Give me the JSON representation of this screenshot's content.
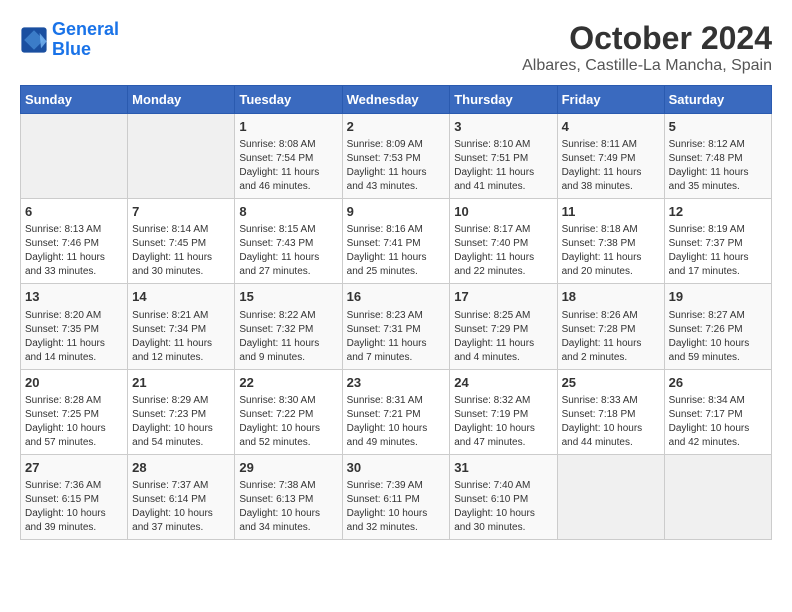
{
  "header": {
    "logo_line1": "General",
    "logo_line2": "Blue",
    "month": "October 2024",
    "location": "Albares, Castille-La Mancha, Spain"
  },
  "days_of_week": [
    "Sunday",
    "Monday",
    "Tuesday",
    "Wednesday",
    "Thursday",
    "Friday",
    "Saturday"
  ],
  "weeks": [
    [
      {
        "day": "",
        "info": ""
      },
      {
        "day": "",
        "info": ""
      },
      {
        "day": "1",
        "info": "Sunrise: 8:08 AM\nSunset: 7:54 PM\nDaylight: 11 hours and 46 minutes."
      },
      {
        "day": "2",
        "info": "Sunrise: 8:09 AM\nSunset: 7:53 PM\nDaylight: 11 hours and 43 minutes."
      },
      {
        "day": "3",
        "info": "Sunrise: 8:10 AM\nSunset: 7:51 PM\nDaylight: 11 hours and 41 minutes."
      },
      {
        "day": "4",
        "info": "Sunrise: 8:11 AM\nSunset: 7:49 PM\nDaylight: 11 hours and 38 minutes."
      },
      {
        "day": "5",
        "info": "Sunrise: 8:12 AM\nSunset: 7:48 PM\nDaylight: 11 hours and 35 minutes."
      }
    ],
    [
      {
        "day": "6",
        "info": "Sunrise: 8:13 AM\nSunset: 7:46 PM\nDaylight: 11 hours and 33 minutes."
      },
      {
        "day": "7",
        "info": "Sunrise: 8:14 AM\nSunset: 7:45 PM\nDaylight: 11 hours and 30 minutes."
      },
      {
        "day": "8",
        "info": "Sunrise: 8:15 AM\nSunset: 7:43 PM\nDaylight: 11 hours and 27 minutes."
      },
      {
        "day": "9",
        "info": "Sunrise: 8:16 AM\nSunset: 7:41 PM\nDaylight: 11 hours and 25 minutes."
      },
      {
        "day": "10",
        "info": "Sunrise: 8:17 AM\nSunset: 7:40 PM\nDaylight: 11 hours and 22 minutes."
      },
      {
        "day": "11",
        "info": "Sunrise: 8:18 AM\nSunset: 7:38 PM\nDaylight: 11 hours and 20 minutes."
      },
      {
        "day": "12",
        "info": "Sunrise: 8:19 AM\nSunset: 7:37 PM\nDaylight: 11 hours and 17 minutes."
      }
    ],
    [
      {
        "day": "13",
        "info": "Sunrise: 8:20 AM\nSunset: 7:35 PM\nDaylight: 11 hours and 14 minutes."
      },
      {
        "day": "14",
        "info": "Sunrise: 8:21 AM\nSunset: 7:34 PM\nDaylight: 11 hours and 12 minutes."
      },
      {
        "day": "15",
        "info": "Sunrise: 8:22 AM\nSunset: 7:32 PM\nDaylight: 11 hours and 9 minutes."
      },
      {
        "day": "16",
        "info": "Sunrise: 8:23 AM\nSunset: 7:31 PM\nDaylight: 11 hours and 7 minutes."
      },
      {
        "day": "17",
        "info": "Sunrise: 8:25 AM\nSunset: 7:29 PM\nDaylight: 11 hours and 4 minutes."
      },
      {
        "day": "18",
        "info": "Sunrise: 8:26 AM\nSunset: 7:28 PM\nDaylight: 11 hours and 2 minutes."
      },
      {
        "day": "19",
        "info": "Sunrise: 8:27 AM\nSunset: 7:26 PM\nDaylight: 10 hours and 59 minutes."
      }
    ],
    [
      {
        "day": "20",
        "info": "Sunrise: 8:28 AM\nSunset: 7:25 PM\nDaylight: 10 hours and 57 minutes."
      },
      {
        "day": "21",
        "info": "Sunrise: 8:29 AM\nSunset: 7:23 PM\nDaylight: 10 hours and 54 minutes."
      },
      {
        "day": "22",
        "info": "Sunrise: 8:30 AM\nSunset: 7:22 PM\nDaylight: 10 hours and 52 minutes."
      },
      {
        "day": "23",
        "info": "Sunrise: 8:31 AM\nSunset: 7:21 PM\nDaylight: 10 hours and 49 minutes."
      },
      {
        "day": "24",
        "info": "Sunrise: 8:32 AM\nSunset: 7:19 PM\nDaylight: 10 hours and 47 minutes."
      },
      {
        "day": "25",
        "info": "Sunrise: 8:33 AM\nSunset: 7:18 PM\nDaylight: 10 hours and 44 minutes."
      },
      {
        "day": "26",
        "info": "Sunrise: 8:34 AM\nSunset: 7:17 PM\nDaylight: 10 hours and 42 minutes."
      }
    ],
    [
      {
        "day": "27",
        "info": "Sunrise: 7:36 AM\nSunset: 6:15 PM\nDaylight: 10 hours and 39 minutes."
      },
      {
        "day": "28",
        "info": "Sunrise: 7:37 AM\nSunset: 6:14 PM\nDaylight: 10 hours and 37 minutes."
      },
      {
        "day": "29",
        "info": "Sunrise: 7:38 AM\nSunset: 6:13 PM\nDaylight: 10 hours and 34 minutes."
      },
      {
        "day": "30",
        "info": "Sunrise: 7:39 AM\nSunset: 6:11 PM\nDaylight: 10 hours and 32 minutes."
      },
      {
        "day": "31",
        "info": "Sunrise: 7:40 AM\nSunset: 6:10 PM\nDaylight: 10 hours and 30 minutes."
      },
      {
        "day": "",
        "info": ""
      },
      {
        "day": "",
        "info": ""
      }
    ]
  ]
}
